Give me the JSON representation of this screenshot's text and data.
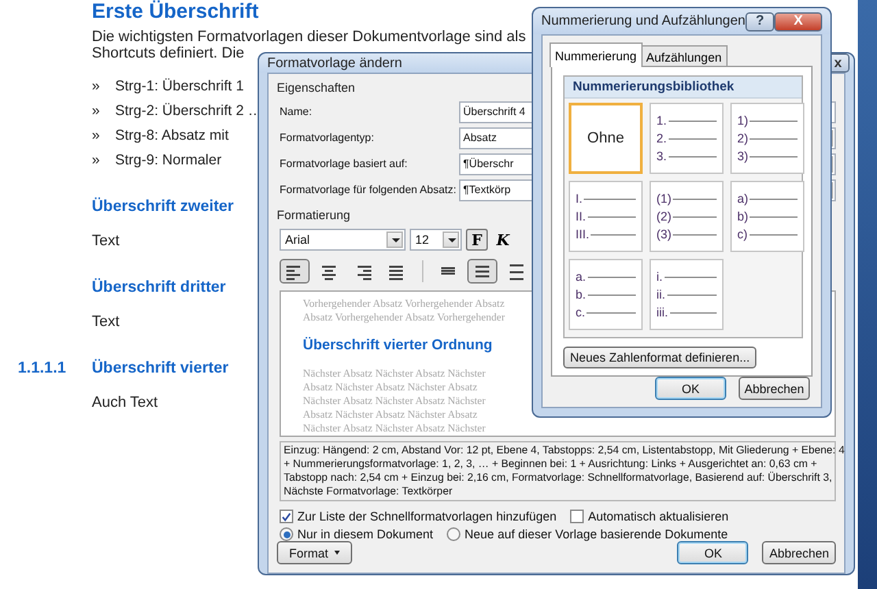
{
  "document": {
    "items": [
      {
        "kind": "h1",
        "text": "Erste Überschrift"
      },
      {
        "kind": "para",
        "text": "Die wichtigsten Formatvorlagen dieser Dokumentvorlage sind als"
      },
      {
        "kind": "para",
        "text": "Shortcuts definiert. Die"
      },
      {
        "kind": "bullet",
        "marker": "»",
        "text": "Strg-1: Überschrift 1"
      },
      {
        "kind": "bullet",
        "marker": "»",
        "text": "Strg-2: Überschrift 2 …"
      },
      {
        "kind": "bullet",
        "marker": "»",
        "text": "Strg-8: Absatz mit"
      },
      {
        "kind": "bullet",
        "marker": "»",
        "text": "Strg-9: Normaler"
      },
      {
        "kind": "h2",
        "text": "Überschrift zweiter"
      },
      {
        "kind": "body",
        "text": "Text"
      },
      {
        "kind": "h2",
        "text": "Überschrift dritter"
      },
      {
        "kind": "body",
        "text": "Text"
      },
      {
        "kind": "h2",
        "number": "1.1.1.1",
        "text": "Überschrift vierter"
      },
      {
        "kind": "body",
        "text": "Auch Text"
      }
    ]
  },
  "style_dialog": {
    "title": "Formatvorlage ändern",
    "close": "x",
    "properties_label": "Eigenschaften",
    "fields": [
      {
        "label": "Name:",
        "kind": "text",
        "value": "Überschrift 4"
      },
      {
        "label": "Formatvorlagentyp:",
        "kind": "select",
        "value": "Absatz"
      },
      {
        "label": "Formatvorlage basiert auf:",
        "kind": "select",
        "mark": "¶",
        "value": "Überschr"
      },
      {
        "label": "Formatvorlage für folgenden Absatz:",
        "kind": "select",
        "mark": "¶",
        "value": "Textkörp"
      }
    ],
    "formatting_label": "Formatierung",
    "font": "Arial",
    "size": "12",
    "style_buttons": [
      {
        "text": "F",
        "selected": true
      },
      {
        "text": "K",
        "selected": false
      }
    ],
    "paragraph_buttons": [
      {
        "kind": "align-left",
        "selected": true
      },
      {
        "kind": "align-center",
        "selected": false
      },
      {
        "kind": "align-right",
        "selected": false
      },
      {
        "kind": "justify",
        "selected": false
      },
      {
        "kind": "spacing-single",
        "selected": false
      },
      {
        "kind": "spacing-medium",
        "selected": true
      },
      {
        "kind": "spacing-double",
        "selected": false
      }
    ],
    "preview": {
      "before": [
        "Vorhergehender Absatz Vorhergehender Absatz",
        "Absatz Vorhergehender Absatz Vorhergehender"
      ],
      "sample": "Überschrift vierter Ordnung",
      "after": [
        "Nächster Absatz Nächster Absatz Nächster",
        "Absatz Nächster Absatz Nächster Absatz",
        "Nächster Absatz Nächster Absatz Nächster",
        "Absatz Nächster Absatz Nächster Absatz",
        "Nächster Absatz Nächster Absatz Nächster"
      ]
    },
    "description": [
      "Einzug: Hängend:  2 cm, Abstand Vor:  12 pt, Ebene 4, Tabstopps:  2,54 cm, Listentabstopp, Mit Gliederung + Ebene: 4",
      "+ Nummerierungsformatvorlage: 1, 2, 3, … + Beginnen bei: 1 + Ausrichtung: Links + Ausgerichtet an:  0,63 cm +",
      "Tabstopp nach:  2,54 cm + Einzug bei:  2,16 cm, Formatvorlage: Schnellformatvorlage, Basierend auf: Überschrift 3,",
      "Nächste Formatvorlage: Textkörper"
    ],
    "checkboxes": [
      {
        "label": "Zur Liste der Schnellformatvorlagen hinzufügen",
        "checked": true
      },
      {
        "label": "Automatisch aktualisieren",
        "checked": false
      }
    ],
    "radios": [
      {
        "label": "Nur in diesem Dokument",
        "selected": true
      },
      {
        "label": "Neue auf dieser Vorlage basierende Dokumente",
        "selected": false
      }
    ],
    "format_button": "Format",
    "ok": "OK",
    "cancel": "Abbrechen"
  },
  "numbering_dialog": {
    "title": "Nummerierung und Aufzählungen",
    "help": "?",
    "close": "X",
    "tabs": [
      {
        "label": "Nummerierung",
        "selected": true
      },
      {
        "label": "Aufzählungen",
        "selected": false
      }
    ],
    "library_title": "Nummerierungsbibliothek",
    "cells": [
      {
        "kind": "none",
        "label": "Ohne",
        "selected": true
      },
      {
        "kind": "list",
        "markers": [
          "1.",
          "2.",
          "3."
        ],
        "selected": false
      },
      {
        "kind": "list",
        "markers": [
          "1)",
          "2)",
          "3)"
        ],
        "selected": false
      },
      {
        "kind": "list",
        "markers": [
          "I.",
          "II.",
          "III."
        ],
        "selected": false
      },
      {
        "kind": "list",
        "markers": [
          "(1)",
          "(2)",
          "(3)"
        ],
        "selected": false
      },
      {
        "kind": "list",
        "markers": [
          "a)",
          "b)",
          "c)"
        ],
        "selected": false
      },
      {
        "kind": "list",
        "markers": [
          "a.",
          "b.",
          "c."
        ],
        "selected": false
      },
      {
        "kind": "list",
        "markers": [
          "i.",
          "ii.",
          "iii."
        ],
        "selected": false
      }
    ],
    "define_button": "Neues Zahlenformat definieren...",
    "ok": "OK",
    "cancel": "Abbrechen"
  }
}
